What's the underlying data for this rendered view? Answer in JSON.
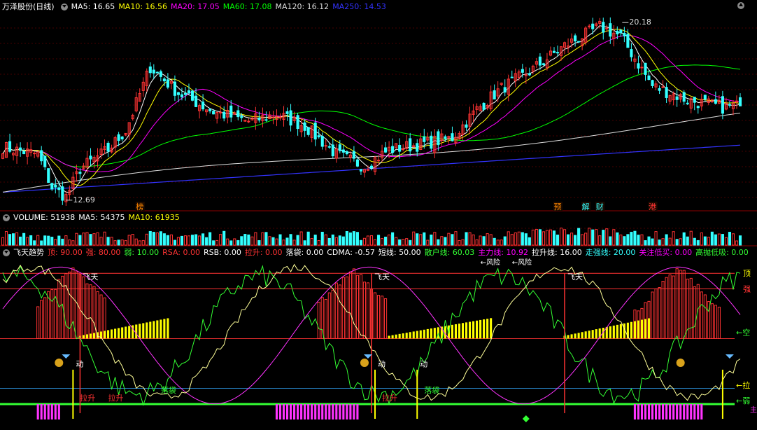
{
  "header": {
    "stock_title": "万泽股份(日线)",
    "ma_items": [
      {
        "label": "MA5: 16.65",
        "color": "#ffffff"
      },
      {
        "label": "MA10: 16.56",
        "color": "#ffff00"
      },
      {
        "label": "MA20: 17.05",
        "color": "#ff00ff"
      },
      {
        "label": "MA60: 17.08",
        "color": "#00ff00"
      },
      {
        "label": "MA120: 16.12",
        "color": "#dddddd"
      },
      {
        "label": "MA250: 14.53",
        "color": "#3333ff"
      }
    ]
  },
  "volume_header": {
    "items": [
      {
        "label": "VOLUME: 51938",
        "color": "#ffffff"
      },
      {
        "label": "MA5: 54375",
        "color": "#ffffff"
      },
      {
        "label": "MA10: 61935",
        "color": "#ffff00"
      }
    ]
  },
  "indicator_header": {
    "items": [
      {
        "label": "飞天趋势",
        "color": "#ffffff"
      },
      {
        "label": "顶: 90.00",
        "color": "#ff3333"
      },
      {
        "label": "强: 80.00",
        "color": "#ff3333"
      },
      {
        "label": "弱: 10.00",
        "color": "#33ff33"
      },
      {
        "label": "RSA: 0.00",
        "color": "#ff3333"
      },
      {
        "label": "RSB: 0.00",
        "color": "#ffffff"
      },
      {
        "label": "拉升: 0.00",
        "color": "#ff3333"
      },
      {
        "label": "落袋: 0.00",
        "color": "#ffffff"
      },
      {
        "label": "CDMA: -0.57",
        "color": "#ffffff"
      },
      {
        "label": "短线: 50.00",
        "color": "#ffffff"
      },
      {
        "label": "散户线: 60.03",
        "color": "#33ff33"
      },
      {
        "label": "主力线: 10.92",
        "color": "#ff00ff"
      },
      {
        "label": "拉升线: 16.00",
        "color": "#ffffff"
      },
      {
        "label": "走强线: 20.00",
        "color": "#33ffff"
      },
      {
        "label": "关注低买: 0.00",
        "color": "#ff00ff"
      },
      {
        "label": "高抛低吸: 0.00",
        "color": "#33ff33"
      }
    ]
  },
  "price_labels": {
    "high": "20.18",
    "low": "12.69"
  },
  "event_tags": [
    {
      "text": "榜",
      "color": "#ff8800",
      "bar": 39
    },
    {
      "text": "预",
      "color": "#ff8800",
      "bar": 158
    },
    {
      "text": "解",
      "color": "#33ffff",
      "bar": 166
    },
    {
      "text": "财",
      "color": "#33ffff",
      "bar": 170
    },
    {
      "text": "港",
      "color": "#ff3333",
      "bar": 185
    }
  ],
  "indicator_labels": {
    "feitian": "飞天",
    "dong": "动",
    "lasheng": "拉升",
    "luodai": "落袋",
    "fengxian": "风险",
    "ding": "顶",
    "qiang": "强",
    "kong": "空",
    "la": "拉",
    "ruo": "弱",
    "zhu": "主"
  },
  "colors": {
    "up": "#ff3333",
    "down": "#33ffff",
    "ma5": "#ffffff",
    "ma10": "#ffff00",
    "ma20": "#ff00ff",
    "ma60": "#00ff00",
    "ma120": "#dddddd",
    "ma250": "#3333ff",
    "grid": "#8b0000"
  },
  "chart_data": {
    "type": "candlestick",
    "y_range": [
      12.3,
      20.6
    ],
    "high": 20.18,
    "low": 12.69,
    "last_close": 16.65,
    "bars": 211,
    "price_keyframes": [
      [
        0,
        14.9
      ],
      [
        10,
        14.6
      ],
      [
        14,
        13.2
      ],
      [
        18,
        12.8
      ],
      [
        22,
        14.0
      ],
      [
        30,
        14.8
      ],
      [
        35,
        15.6
      ],
      [
        42,
        18.3
      ],
      [
        50,
        17.2
      ],
      [
        60,
        16.4
      ],
      [
        70,
        16.0
      ],
      [
        78,
        16.3
      ],
      [
        86,
        15.8
      ],
      [
        95,
        14.6
      ],
      [
        103,
        14.1
      ],
      [
        110,
        14.8
      ],
      [
        118,
        15.0
      ],
      [
        128,
        15.3
      ],
      [
        135,
        16.5
      ],
      [
        142,
        17.4
      ],
      [
        150,
        18.1
      ],
      [
        160,
        19.2
      ],
      [
        170,
        20.0
      ],
      [
        176,
        19.6
      ],
      [
        185,
        17.5
      ],
      [
        195,
        16.9
      ],
      [
        205,
        16.6
      ],
      [
        210,
        16.65
      ]
    ],
    "ma250_range": [
      14.3,
      14.6
    ]
  }
}
